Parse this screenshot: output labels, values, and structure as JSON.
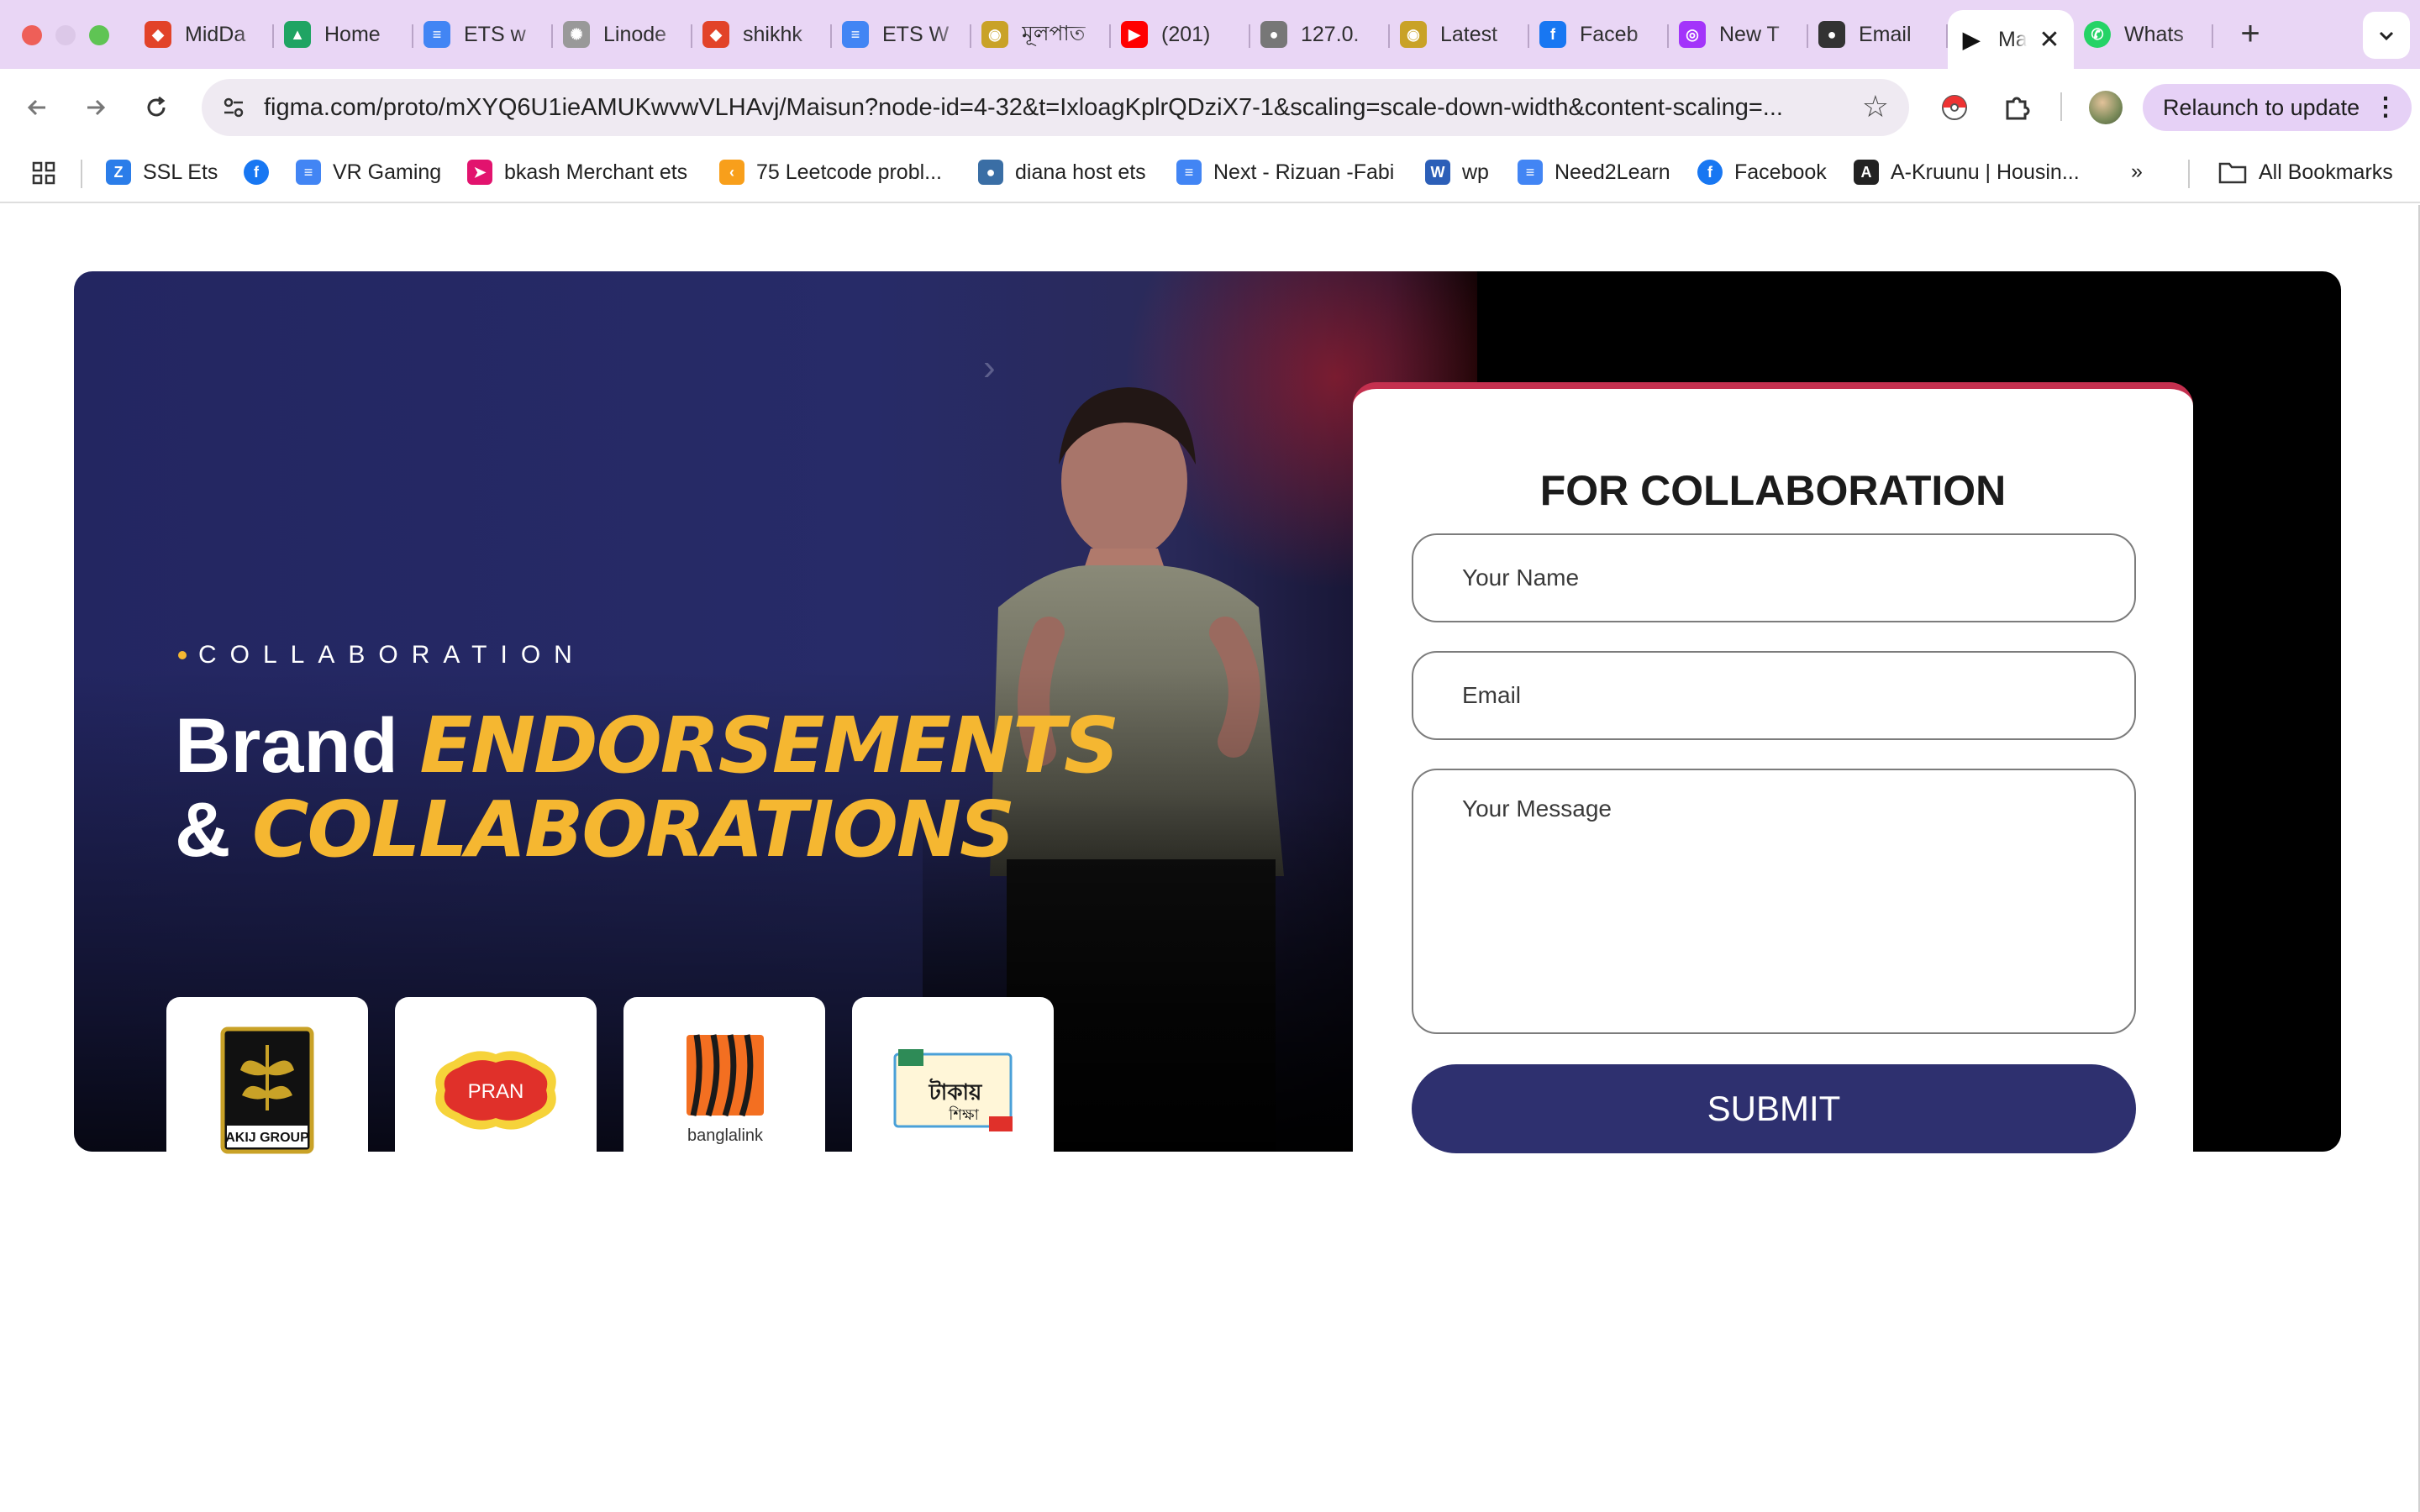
{
  "browser": {
    "tabs": [
      {
        "label": "MidDa",
        "icon": "gitlab-icon",
        "color": "#e24329"
      },
      {
        "label": "Home",
        "icon": "google-drive-icon",
        "color": "#1fa463"
      },
      {
        "label": "ETS w",
        "icon": "google-docs-icon",
        "color": "#4285f4"
      },
      {
        "label": "Linode",
        "icon": "openai-icon",
        "color": "#999999"
      },
      {
        "label": "shikhk",
        "icon": "gitlab-icon",
        "color": "#e24329"
      },
      {
        "label": "ETS W",
        "icon": "google-docs-icon",
        "color": "#4285f4"
      },
      {
        "label": "মূলপাত",
        "icon": "site-logo-icon",
        "color": "#c9a227"
      },
      {
        "label": "(201) ",
        "icon": "youtube-icon",
        "color": "#ff0000"
      },
      {
        "label": "127.0.",
        "icon": "globe-icon",
        "color": "#777777"
      },
      {
        "label": "Latest",
        "icon": "site-logo-icon",
        "color": "#c9a227"
      },
      {
        "label": "Faceb",
        "icon": "facebook-icon",
        "color": "#1877f2"
      },
      {
        "label": "New T",
        "icon": "messenger-icon",
        "color": "#a334fa"
      },
      {
        "label": "Email ",
        "icon": "github-icon",
        "color": "#333333"
      }
    ],
    "active_tab": {
      "label": "Ma",
      "icon": "figma-play-icon"
    },
    "after_tab": {
      "label": "Whats",
      "icon": "whatsapp-icon",
      "color": "#25d366"
    },
    "url": "figma.com/proto/mXYQ6U1ieAMUKwvwVLHAvj/Maisun?node-id=4-32&t=IxloagKplrQDziX7-1&scaling=scale-down-width&content-scaling=...",
    "relaunch_label": "Relaunch to update",
    "bookmarks": [
      {
        "label": "SSL Ets",
        "icon": "ssl-icon",
        "color": "#2b7de9"
      },
      {
        "label": "",
        "icon": "facebook-icon",
        "color": "#1877f2"
      },
      {
        "label": "VR Gaming",
        "icon": "google-docs-icon",
        "color": "#4285f4"
      },
      {
        "label": "bkash Merchant ets",
        "icon": "bkash-icon",
        "color": "#e2136e"
      },
      {
        "label": "75 Leetcode probl...",
        "icon": "leetcode-icon",
        "color": "#f89f1b"
      },
      {
        "label": "diana host ets",
        "icon": "host-icon",
        "color": "#3a6ea5"
      },
      {
        "label": "Next - Rizuan -Fabi",
        "icon": "google-docs-icon",
        "color": "#4285f4"
      },
      {
        "label": "wp",
        "icon": "wp-icon",
        "color": "#2c5fb8"
      },
      {
        "label": "Need2Learn",
        "icon": "google-docs-icon",
        "color": "#4285f4"
      },
      {
        "label": "Facebook",
        "icon": "facebook-icon",
        "color": "#1877f2"
      },
      {
        "label": "A-Kruunu | Housin...",
        "icon": "akruunu-icon",
        "color": "#222222"
      }
    ],
    "all_bookmarks_label": "All Bookmarks"
  },
  "banner": {
    "eyebrow": "COLLABORATION",
    "headline_word1": "Brand",
    "headline_accent1": "ENDORSEMENTS",
    "headline_word2": "&",
    "headline_accent2": "COLLABORATIONS",
    "accent_color": "#f5b731",
    "logos": [
      {
        "name": "akij-group-logo",
        "text": "AKIJ GROUP"
      },
      {
        "name": "pran-logo",
        "text": "PRAN"
      },
      {
        "name": "banglalink-logo",
        "text": "banglalink"
      },
      {
        "name": "takay-shikkha-logo",
        "text": "টাকায় শিক্ষা"
      }
    ]
  },
  "form": {
    "title": "FOR COLLABORATION",
    "name_placeholder": "Your Name",
    "email_placeholder": "Email",
    "message_placeholder": "Your Message",
    "submit_label": "SUBMIT",
    "top_accent_color": "#c4304f",
    "button_color": "#2e306f"
  }
}
